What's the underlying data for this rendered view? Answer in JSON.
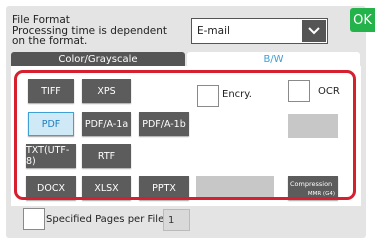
{
  "header": {
    "label_line1": "File Format",
    "label_line2": "Processing time is dependent",
    "label_line3": "on the format.",
    "select_value": "E-mail",
    "ok_label": "OK"
  },
  "tabs": [
    "Color/Grayscale",
    "B/W"
  ],
  "formats": {
    "tiff": "TIFF",
    "xps": "XPS",
    "pdf": "PDF",
    "pdfa1a": "PDF/A-1a",
    "pdfa1b": "PDF/A-1b",
    "txt": "TXT(UTF-8)",
    "rtf": "RTF",
    "docx": "DOCX",
    "xlsx": "XLSX",
    "pptx": "PPTX"
  },
  "selected_format": "PDF",
  "options": {
    "encry_label": "Encry.",
    "ocr_label": "OCR",
    "compression_label": "Compression",
    "compression_value": "MMR (G4)"
  },
  "specified": {
    "label": "Specified Pages per File",
    "value": "1"
  },
  "colors": {
    "highlight_border": "#d6202f",
    "selected_tab": "#3ea0d4",
    "ok_green": "#24b34b",
    "button_dark": "#5c5c5c"
  }
}
